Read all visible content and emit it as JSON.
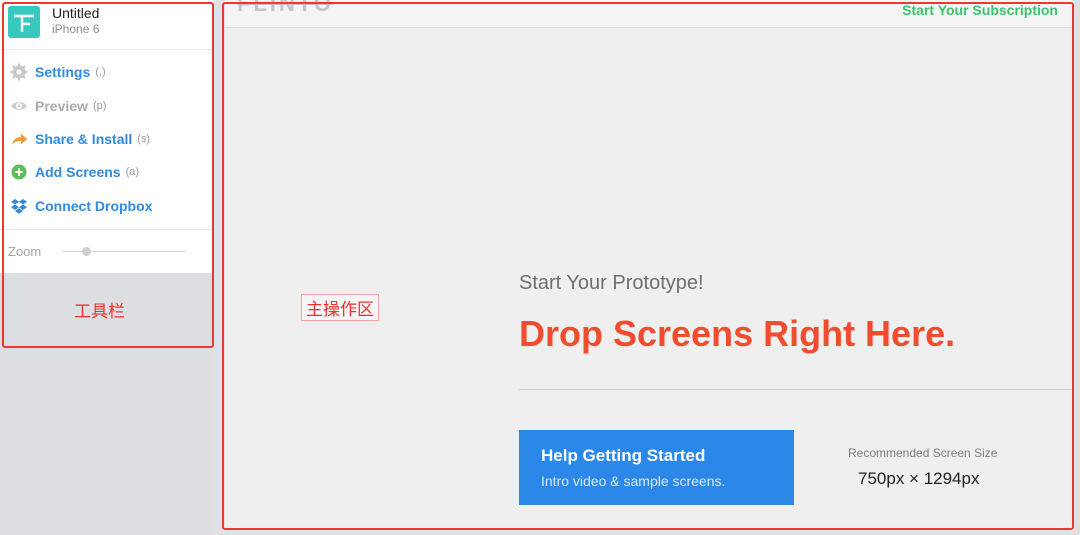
{
  "app": {
    "title": "Untitled",
    "device": "iPhone 6"
  },
  "menu": [
    {
      "label": "Settings",
      "shortcut": "(,)",
      "icon": "gear-icon"
    },
    {
      "label": "Preview",
      "shortcut": "(p)",
      "icon": "eye-icon"
    },
    {
      "label": "Share & Install",
      "shortcut": "(s)",
      "icon": "share-arrow-icon"
    },
    {
      "label": "Add Screens",
      "shortcut": "(a)",
      "icon": "plus-circle-icon"
    },
    {
      "label": "Connect Dropbox",
      "shortcut": "",
      "icon": "dropbox-icon"
    }
  ],
  "zoom": {
    "label": "Zoom",
    "value": 0.2
  },
  "annotations": {
    "toolbar": "工具栏",
    "main": "主操作区"
  },
  "main": {
    "brand": "FLINTO",
    "subscribe": "Start Your Subscription",
    "subtitle": "Start Your Prototype!",
    "headline": "Drop Screens Right Here.",
    "help_title": "Help Getting Started",
    "help_sub": "Intro video & sample screens.",
    "rec_label": "Recommended Screen Size",
    "rec_size": "750px × 1294px"
  },
  "colors": {
    "accent": "#2f8ae0",
    "headline": "#f24c2f",
    "subscribe": "#3cc46c",
    "annotation": "#e83a34",
    "app_icon": "#37c8c0"
  }
}
